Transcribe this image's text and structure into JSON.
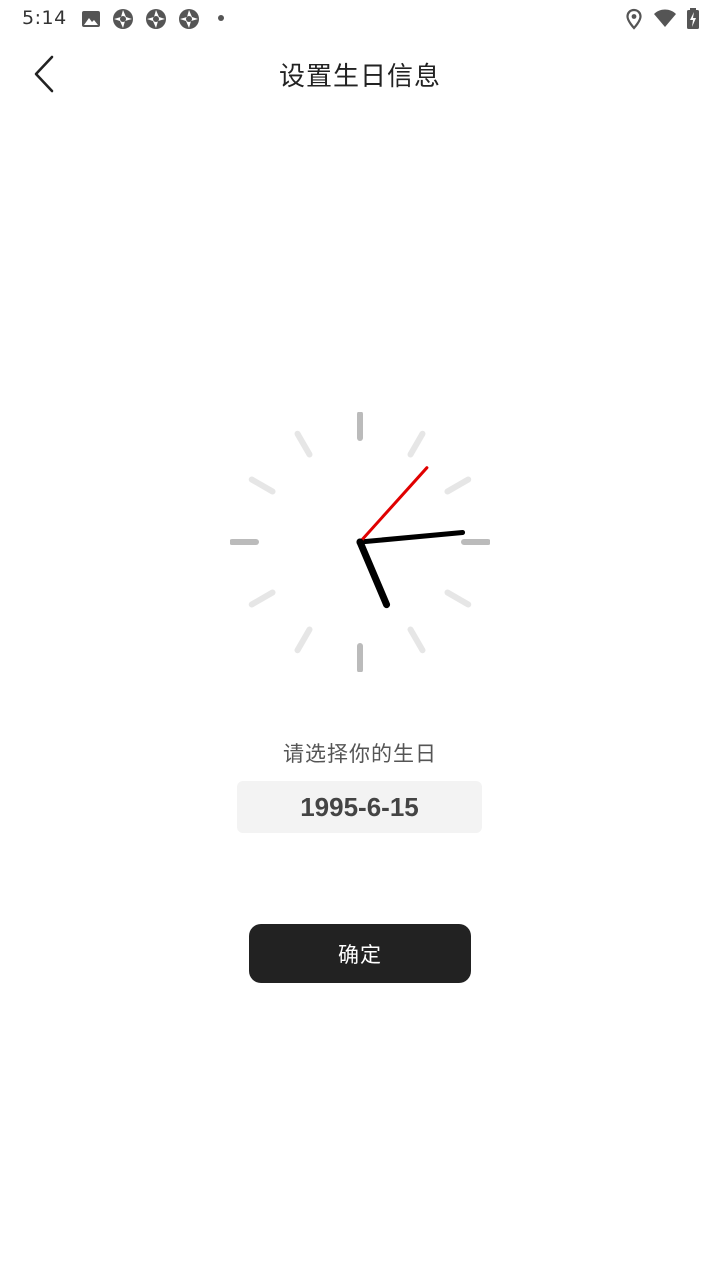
{
  "status_bar": {
    "time": "5:14",
    "left_icons": [
      "image-icon",
      "app-notification-icon",
      "app-notification-icon",
      "app-notification-icon",
      "more-dot-icon"
    ],
    "right_icons": [
      "location-icon",
      "wifi-icon",
      "battery-charging-icon"
    ]
  },
  "app_bar": {
    "title": "设置生日信息",
    "back_icon": "chevron-left-icon"
  },
  "clock": {
    "hour": 5,
    "minute": 14,
    "second": 7,
    "colors": {
      "hands": "#000000",
      "second_hand": "#e00000",
      "major_tick": "#bbbbbb",
      "minor_tick": "#e6e6e6"
    }
  },
  "birthday": {
    "prompt": "请选择你的生日",
    "value": "1995-6-15"
  },
  "confirm": {
    "label": "确定"
  },
  "colors": {
    "accent": "#222222",
    "background": "#ffffff",
    "field_background": "#f3f3f3"
  }
}
